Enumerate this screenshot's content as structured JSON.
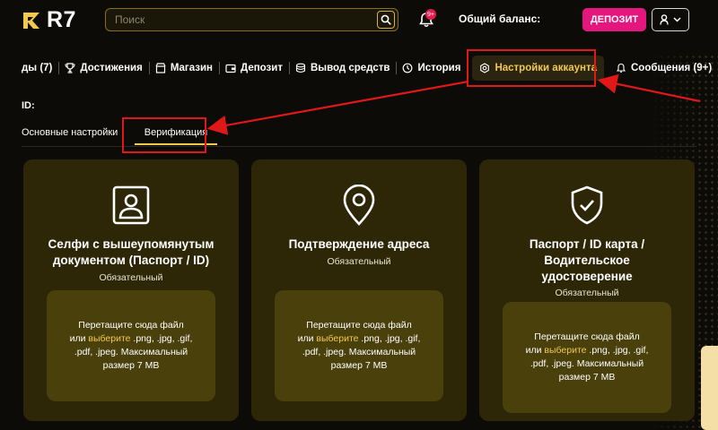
{
  "header": {
    "logo_text": "R7",
    "search_placeholder": "Поиск",
    "notifications_badge": "9+",
    "balance_label": "Общий баланс:",
    "deposit_label": "ДЕПОЗИТ",
    "user_icon_glyph": "Я"
  },
  "nav": {
    "items": [
      {
        "label": "ды (7)",
        "icon": "bonus-icon"
      },
      {
        "label": "Достижения",
        "icon": "trophy-icon"
      },
      {
        "label": "Магазин",
        "icon": "store-icon"
      },
      {
        "label": "Депозит",
        "icon": "wallet-icon"
      },
      {
        "label": "Вывод средств",
        "icon": "coins-icon"
      },
      {
        "label": "История",
        "icon": "clock-icon"
      },
      {
        "label": "Настройки аккаунта",
        "icon": "gear-icon",
        "active": true
      },
      {
        "label": "Сообщения (9+)",
        "icon": "bell-icon"
      }
    ]
  },
  "account": {
    "id_label": "ID:",
    "subtabs": [
      {
        "label": "Основные настройки"
      },
      {
        "label": "Верификация",
        "active": true
      }
    ]
  },
  "cards": [
    {
      "icon": "id-card-icon",
      "title": "Селфи с вышеупомянутым документом (Паспорт / ID)",
      "subtitle": "Обязательный",
      "drop_text_1": "Перетащите сюда файл",
      "drop_text_2": "или",
      "drop_link": "выберите",
      "drop_text_3": ".png, .jpg, .gif, .pdf, .jpeg. Максимальный размер 7 MB"
    },
    {
      "icon": "location-pin-icon",
      "title": "Подтверждение адреса",
      "subtitle": "Обязательный",
      "drop_text_1": "Перетащите сюда файл",
      "drop_text_2": "или",
      "drop_link": "выберите",
      "drop_text_3": ".png, .jpg, .gif, .pdf, .jpeg. Максимальный размер 7 MB"
    },
    {
      "icon": "shield-check-icon",
      "title": "Паспорт / ID карта / Водительское удостоверение",
      "subtitle": "Обязательный",
      "drop_text_1": "Перетащите сюда файл",
      "drop_text_2": "или",
      "drop_link": "выберите",
      "drop_text_3": ".png, .jpg, .gif, .pdf, .jpeg. Максимальный размер 7 MB"
    }
  ],
  "colors": {
    "accent": "#f2c94c",
    "deposit": "#e5177f",
    "card_bg": "#2d2708",
    "dropzone_bg": "#4a400c",
    "annotation": "#e01818"
  }
}
